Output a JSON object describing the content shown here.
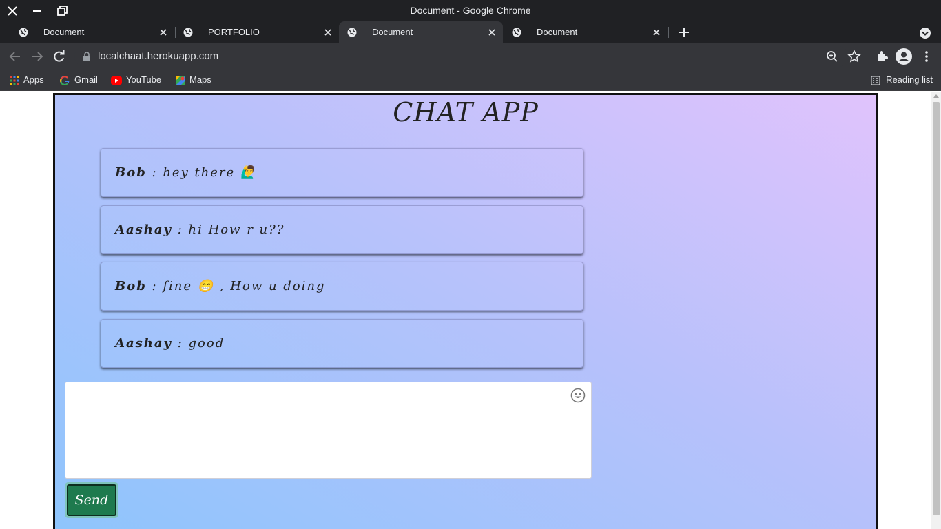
{
  "window": {
    "title": "Document - Google Chrome"
  },
  "tabs": [
    {
      "label": "Document",
      "active": false
    },
    {
      "label": "PORTFOLIO",
      "active": false
    },
    {
      "label": "Document",
      "active": true
    },
    {
      "label": "Document",
      "active": false
    }
  ],
  "address_bar": {
    "url": "localchaat.herokuapp.com"
  },
  "bookmarks": {
    "items": [
      {
        "label": "Apps",
        "icon": "apps-grid-icon"
      },
      {
        "label": "Gmail",
        "icon": "google-icon"
      },
      {
        "label": "YouTube",
        "icon": "youtube-icon"
      },
      {
        "label": "Maps",
        "icon": "maps-icon"
      }
    ],
    "reading_list": "Reading list"
  },
  "page": {
    "title": "CHAT APP",
    "messages": [
      {
        "sender": "Bob",
        "text": " : hey there 🙋‍♂️"
      },
      {
        "sender": "Aashay",
        "text": " : hi How r u??"
      },
      {
        "sender": "Bob",
        "text": " : fine 😁 , How u doing"
      },
      {
        "sender": "Aashay",
        "text": " : good"
      }
    ],
    "composer": {
      "value": "",
      "emoji_icon": "smiley-icon"
    },
    "send_label": "Send"
  },
  "colors": {
    "chrome_dark": "#202124",
    "chrome_toolbar": "#35363a",
    "gradient_start": "#8ec5fc",
    "gradient_end": "#e0c3fc",
    "send_button": "#1e7a4e"
  }
}
